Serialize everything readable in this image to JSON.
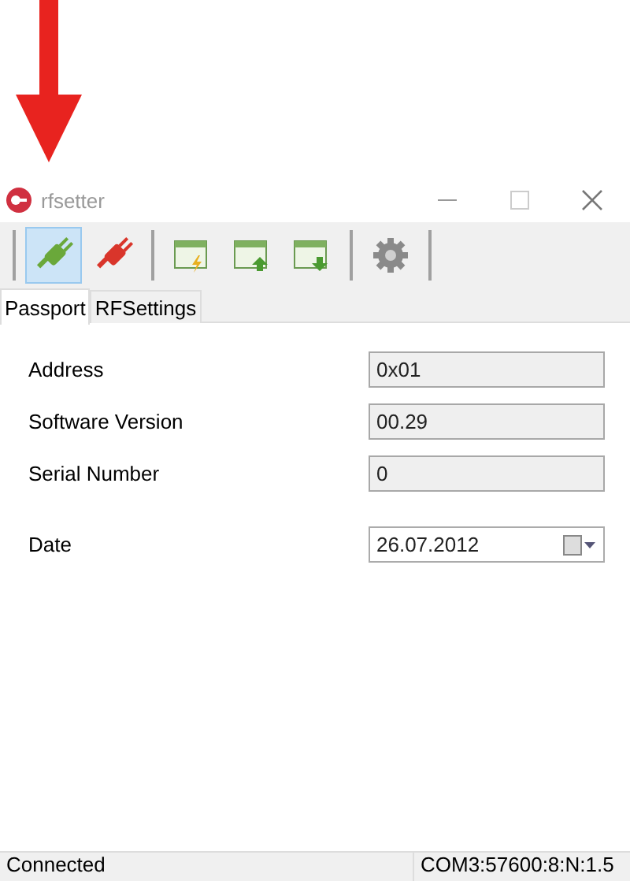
{
  "window": {
    "title": "rfsetter"
  },
  "toolbar": [
    {
      "kind": "separator"
    },
    {
      "kind": "connect",
      "selected": true
    },
    {
      "kind": "disconnect",
      "selected": false
    },
    {
      "kind": "separator"
    },
    {
      "kind": "write",
      "selected": false
    },
    {
      "kind": "upload",
      "selected": false
    },
    {
      "kind": "download",
      "selected": false
    },
    {
      "kind": "separator"
    },
    {
      "kind": "settings",
      "selected": false
    },
    {
      "kind": "separator"
    }
  ],
  "tabs": [
    {
      "label": "Passport",
      "selected": true
    },
    {
      "label": "RFSettings",
      "selected": false
    }
  ],
  "fields": [
    {
      "label": "Address",
      "value": "0x01",
      "kind": "text"
    },
    {
      "label": "Software Version",
      "value": "00.29",
      "kind": "text"
    },
    {
      "label": "Serial Number",
      "value": "0",
      "kind": "text"
    },
    {
      "label": "Date",
      "value": "26.07.2012",
      "kind": "date"
    }
  ],
  "status_bar": {
    "state": "Connected",
    "port": "COM3:57600:8:N:1.5"
  }
}
